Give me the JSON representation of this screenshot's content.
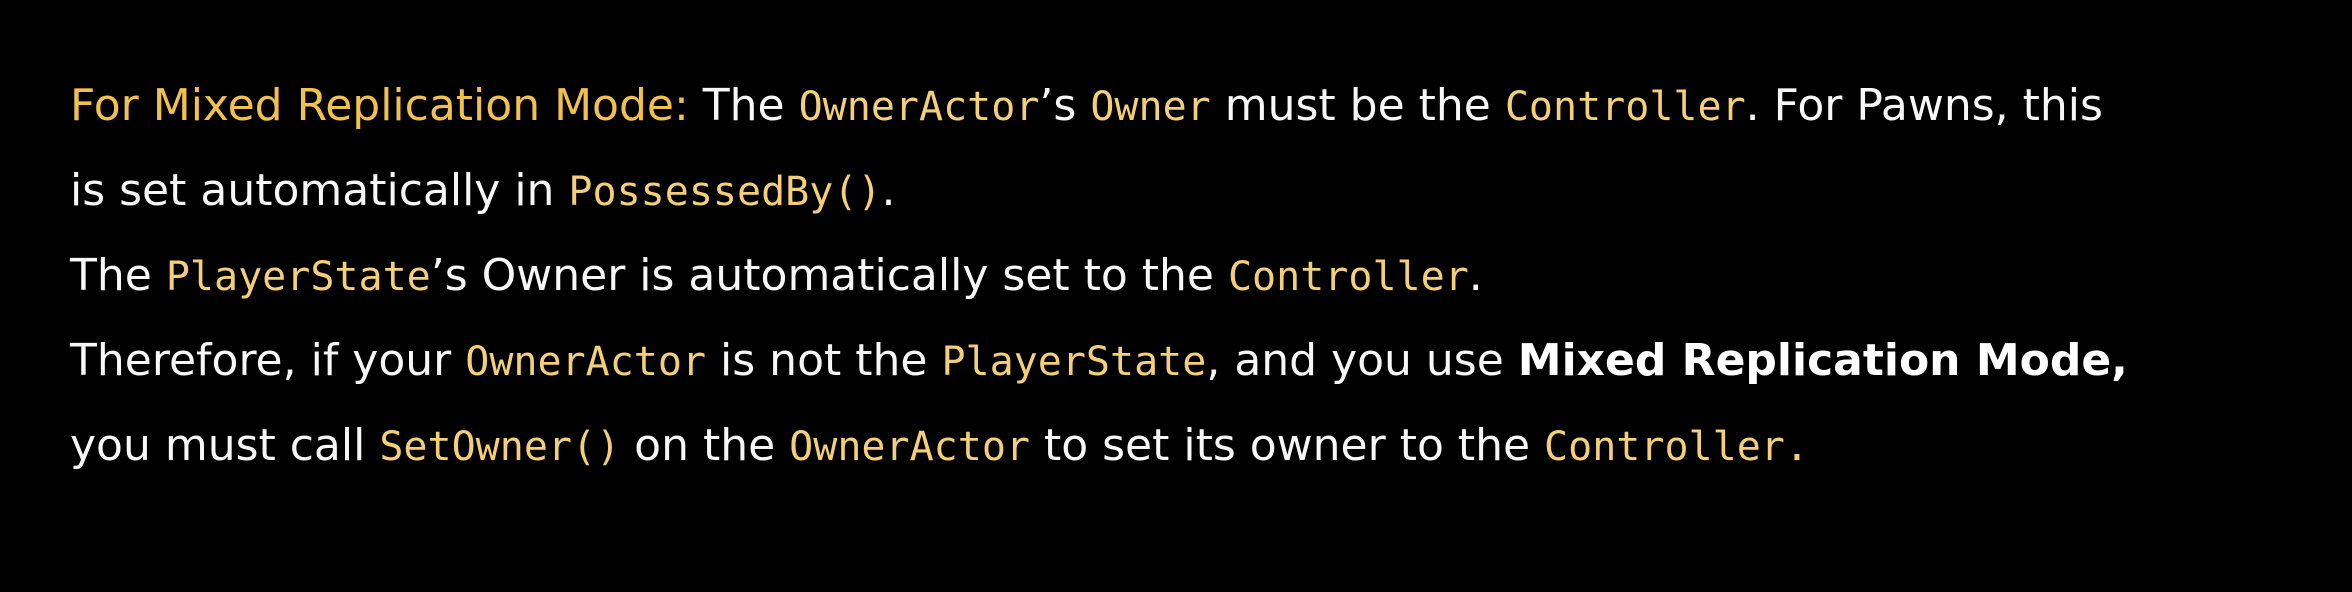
{
  "note": {
    "line1": {
      "heading": "For Mixed Replication Mode:",
      "t1": " The ",
      "c1": "OwnerActor",
      "t2": "’s ",
      "c2": "Owner",
      "t3": " must be the ",
      "c3": "Controller",
      "t4": ". For Pawns, this"
    },
    "line2": {
      "t1": "is set automatically in ",
      "c1": "PossessedBy()",
      "t2": "."
    },
    "line3": {
      "t1": "The ",
      "c1": "PlayerState",
      "t2": "’s Owner is automatically set to the ",
      "c2": "Controller",
      "t3": "."
    },
    "line4": {
      "t1": "Therefore, if your ",
      "c1": "OwnerActor",
      "t2": " is not the ",
      "c2": "PlayerState",
      "t3": ", and you use ",
      "b1": "Mixed Replication Mode,"
    },
    "line5": {
      "t1": "you must call ",
      "c1": "SetOwner()",
      "t2": " on the ",
      "c2": "OwnerActor",
      "t3": " to set its owner to the ",
      "c3": "Controller."
    }
  },
  "colors": {
    "background": "#000000",
    "text": "#f7f7f7",
    "heading": "#f2c04d",
    "code": "#f4cf77"
  }
}
